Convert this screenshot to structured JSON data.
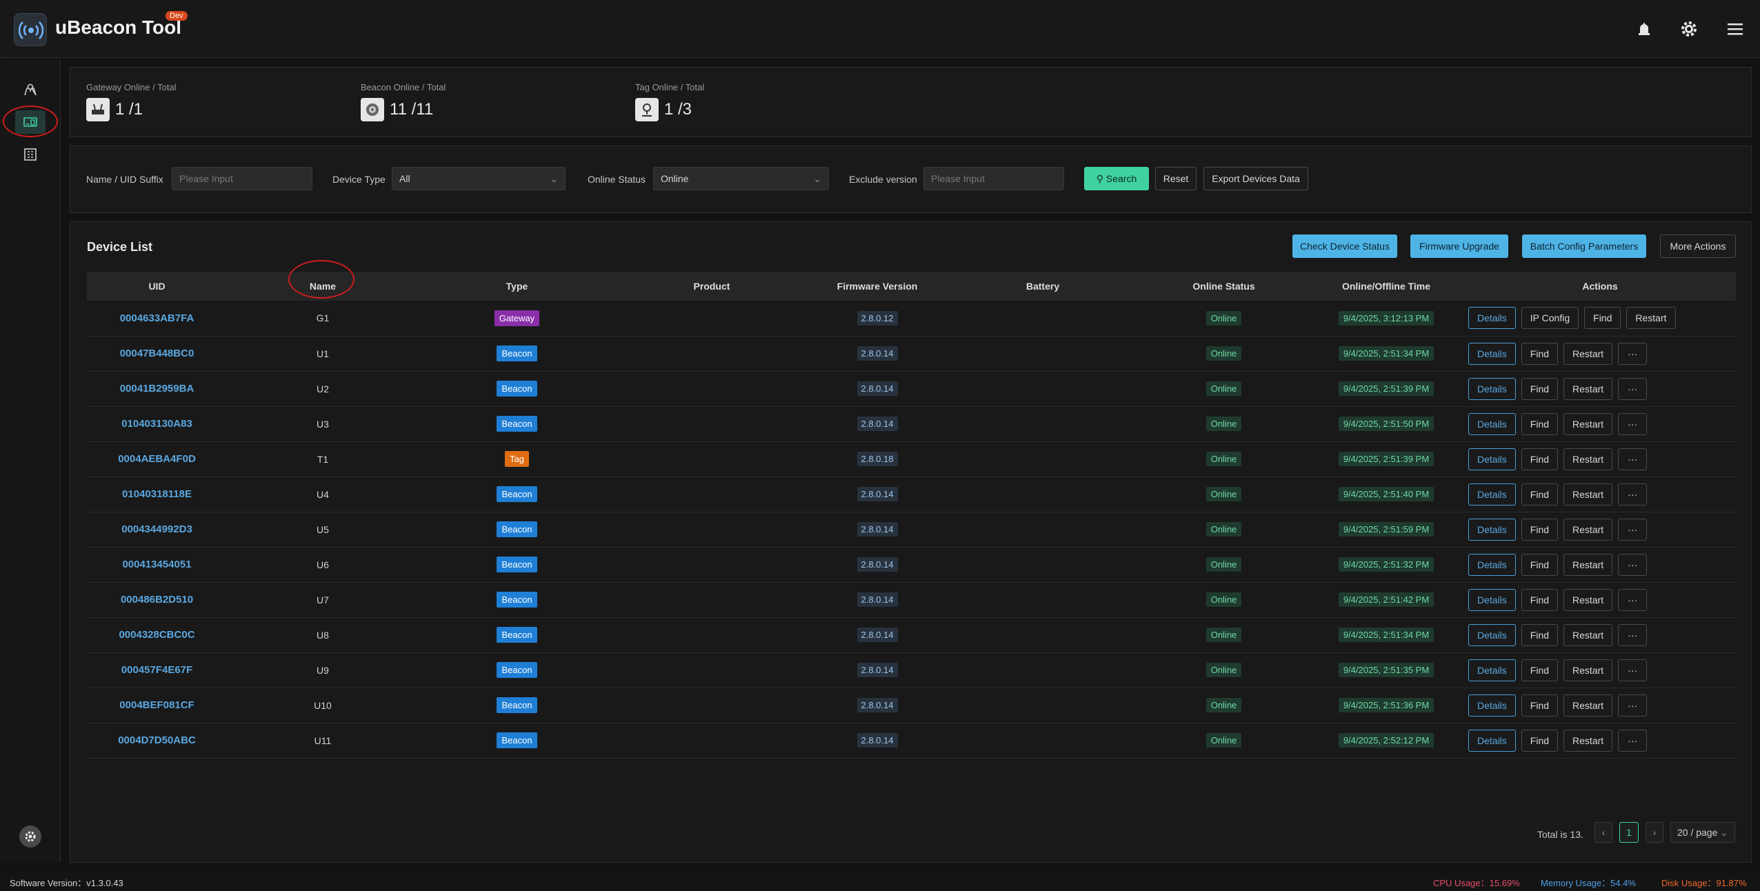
{
  "header": {
    "title": "uBeacon Tool",
    "badge": "Dev",
    "icons": [
      "broadcast-logo-icon",
      "alarm-bell-icon",
      "gear-icon",
      "menu-icon"
    ]
  },
  "sidebar": {
    "items": [
      "map-pin-icon",
      "devices-icon",
      "building-icon"
    ],
    "active": 1,
    "bottom_icon": "settings-icon"
  },
  "stats": [
    {
      "label": "Gateway Online / Total",
      "value": "1 /1",
      "icon": "gateway-icon"
    },
    {
      "label": "Beacon Online / Total",
      "value": "11 /11",
      "icon": "beacon-icon"
    },
    {
      "label": "Tag Online / Total",
      "value": "1 /3",
      "icon": "tag-pin-icon"
    }
  ],
  "filters": {
    "name_label": "Name / UID Suffix",
    "name_placeholder": "Please Input",
    "type_label": "Device Type",
    "type_value": "All",
    "status_label": "Online Status",
    "status_value": "Online",
    "exclude_label": "Exclude version",
    "exclude_placeholder": "Please Input",
    "search": "Search",
    "reset": "Reset",
    "export": "Export Devices Data"
  },
  "device_list": {
    "title": "Device List",
    "buttons": {
      "check": "Check Device Status",
      "firmware": "Firmware Upgrade",
      "batch": "Batch Config Parameters",
      "more": "More Actions"
    },
    "columns": [
      "UID",
      "Name",
      "Type",
      "Product",
      "Firmware Version",
      "Battery",
      "Online Status",
      "Online/Offline Time",
      "Actions"
    ],
    "rows": [
      {
        "uid": "0004633AB7FA",
        "name": "G1",
        "type": "Gateway",
        "fw": "2.8.0.12",
        "status": "Online",
        "time": "9/4/2025, 3:12:13 PM",
        "actions": [
          "Details",
          "IP Config",
          "Find",
          "Restart"
        ]
      },
      {
        "uid": "00047B448BC0",
        "name": "U1",
        "type": "Beacon",
        "fw": "2.8.0.14",
        "status": "Online",
        "time": "9/4/2025, 2:51:34 PM",
        "actions": [
          "Details",
          "Find",
          "Restart",
          "···"
        ]
      },
      {
        "uid": "00041B2959BA",
        "name": "U2",
        "type": "Beacon",
        "fw": "2.8.0.14",
        "status": "Online",
        "time": "9/4/2025, 2:51:39 PM",
        "actions": [
          "Details",
          "Find",
          "Restart",
          "···"
        ]
      },
      {
        "uid": "010403130A83",
        "name": "U3",
        "type": "Beacon",
        "fw": "2.8.0.14",
        "status": "Online",
        "time": "9/4/2025, 2:51:50 PM",
        "actions": [
          "Details",
          "Find",
          "Restart",
          "···"
        ]
      },
      {
        "uid": "0004AEBA4F0D",
        "name": "T1",
        "type": "Tag",
        "fw": "2.8.0.18",
        "status": "Online",
        "time": "9/4/2025, 2:51:39 PM",
        "actions": [
          "Details",
          "Find",
          "Restart",
          "···"
        ]
      },
      {
        "uid": "01040318118E",
        "name": "U4",
        "type": "Beacon",
        "fw": "2.8.0.14",
        "status": "Online",
        "time": "9/4/2025, 2:51:40 PM",
        "actions": [
          "Details",
          "Find",
          "Restart",
          "···"
        ]
      },
      {
        "uid": "0004344992D3",
        "name": "U5",
        "type": "Beacon",
        "fw": "2.8.0.14",
        "status": "Online",
        "time": "9/4/2025, 2:51:59 PM",
        "actions": [
          "Details",
          "Find",
          "Restart",
          "···"
        ]
      },
      {
        "uid": "000413454051",
        "name": "U6",
        "type": "Beacon",
        "fw": "2.8.0.14",
        "status": "Online",
        "time": "9/4/2025, 2:51:32 PM",
        "actions": [
          "Details",
          "Find",
          "Restart",
          "···"
        ]
      },
      {
        "uid": "000486B2D510",
        "name": "U7",
        "type": "Beacon",
        "fw": "2.8.0.14",
        "status": "Online",
        "time": "9/4/2025, 2:51:42 PM",
        "actions": [
          "Details",
          "Find",
          "Restart",
          "···"
        ]
      },
      {
        "uid": "0004328CBC0C",
        "name": "U8",
        "type": "Beacon",
        "fw": "2.8.0.14",
        "status": "Online",
        "time": "9/4/2025, 2:51:34 PM",
        "actions": [
          "Details",
          "Find",
          "Restart",
          "···"
        ]
      },
      {
        "uid": "000457F4E67F",
        "name": "U9",
        "type": "Beacon",
        "fw": "2.8.0.14",
        "status": "Online",
        "time": "9/4/2025, 2:51:35 PM",
        "actions": [
          "Details",
          "Find",
          "Restart",
          "···"
        ]
      },
      {
        "uid": "0004BEF081CF",
        "name": "U10",
        "type": "Beacon",
        "fw": "2.8.0.14",
        "status": "Online",
        "time": "9/4/2025, 2:51:36 PM",
        "actions": [
          "Details",
          "Find",
          "Restart",
          "···"
        ]
      },
      {
        "uid": "0004D7D50ABC",
        "name": "U11",
        "type": "Beacon",
        "fw": "2.8.0.14",
        "status": "Online",
        "time": "9/4/2025, 2:52:12 PM",
        "actions": [
          "Details",
          "Find",
          "Restart",
          "···"
        ]
      }
    ]
  },
  "pagination": {
    "total": "Total is 13.",
    "prev": "‹",
    "page": "1",
    "next": "›",
    "page_size": "20 / page"
  },
  "footer": {
    "version": "Software Version：v1.3.0.43",
    "cpu": "CPU Usage：15.69%",
    "memory": "Memory Usage：54.4%",
    "disk": "Disk Usage：91.87%"
  },
  "colors": {
    "accent_green": "#3fd2a0",
    "accent_blue": "#4eb4e6",
    "cpu": "#e84f6a",
    "memory": "#4e9fe6",
    "disk": "#f06a2a"
  }
}
